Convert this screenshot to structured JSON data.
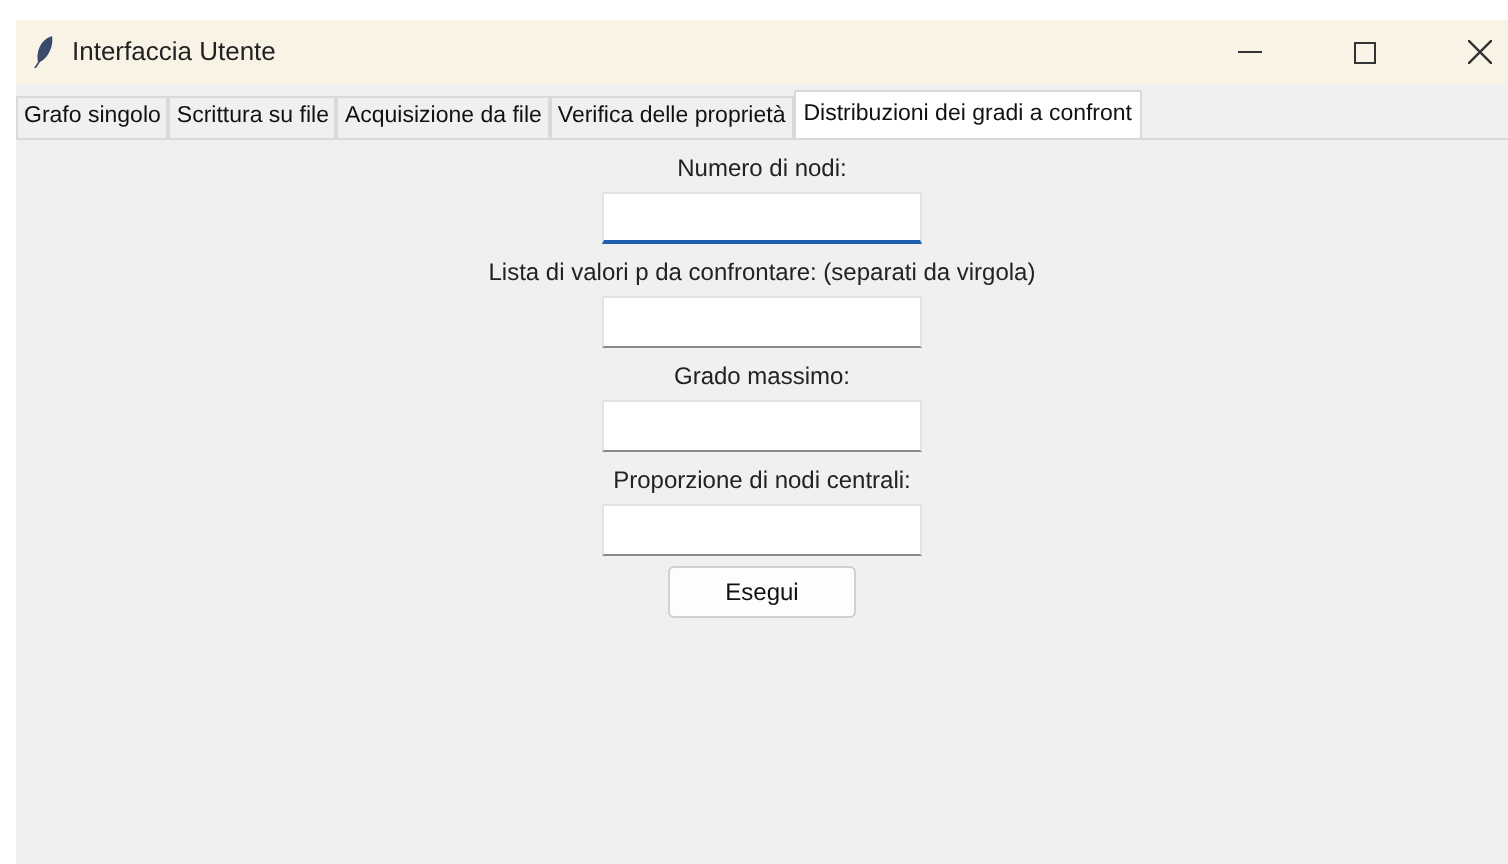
{
  "window": {
    "title": "Interfaccia Utente"
  },
  "tabs": [
    {
      "label": "Grafo singolo",
      "selected": false
    },
    {
      "label": "Scrittura su file",
      "selected": false
    },
    {
      "label": "Acquisizione da file",
      "selected": false
    },
    {
      "label": "Verifica delle proprietà",
      "selected": false
    },
    {
      "label": "Distribuzioni dei gradi a confront",
      "selected": true
    }
  ],
  "form": {
    "fields": [
      {
        "label": "Numero di nodi:",
        "focused": true
      },
      {
        "label": "Lista di valori p da confrontare: (separati da virgola)",
        "focused": false
      },
      {
        "label": "Grado massimo:",
        "focused": false
      },
      {
        "label": "Proporzione di nodi centrali:",
        "focused": false
      }
    ],
    "button": "Esegui"
  }
}
